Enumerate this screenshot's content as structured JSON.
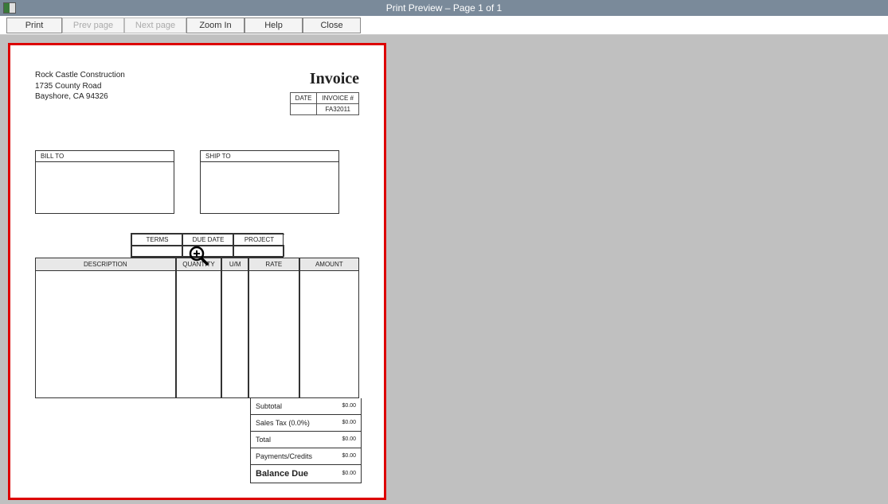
{
  "window": {
    "title": "Print Preview – Page 1 of 1"
  },
  "toolbar": {
    "print": "Print",
    "prev": "Prev page",
    "next": "Next page",
    "zoom": "Zoom In",
    "help": "Help",
    "close": "Close"
  },
  "invoice": {
    "company": {
      "name": "Rock Castle Construction",
      "street": "1735 County Road",
      "citystate": "Bayshore, CA 94326"
    },
    "title": "Invoice",
    "meta": {
      "date_label": "DATE",
      "invnum_label": "INVOICE #",
      "date_value": "",
      "invnum_value": "FA32011"
    },
    "bill_to_label": "BILL TO",
    "ship_to_label": "SHIP TO",
    "terms_label": "TERMS",
    "due_label": "DUE DATE",
    "project_label": "PROJECT",
    "cols": {
      "desc": "DESCRIPTION",
      "qty": "QUANTITY",
      "um": "U/M",
      "rate": "RATE",
      "amt": "AMOUNT"
    },
    "summary": {
      "subtotal_label": "Subtotal",
      "subtotal_value": "$0.00",
      "tax_label": "Sales Tax  (0.0%)",
      "tax_value": "$0.00",
      "total_label": "Total",
      "total_value": "$0.00",
      "pay_label": "Payments/Credits",
      "pay_value": "$0.00",
      "bal_label": "Balance Due",
      "bal_value": "$0.00"
    }
  }
}
